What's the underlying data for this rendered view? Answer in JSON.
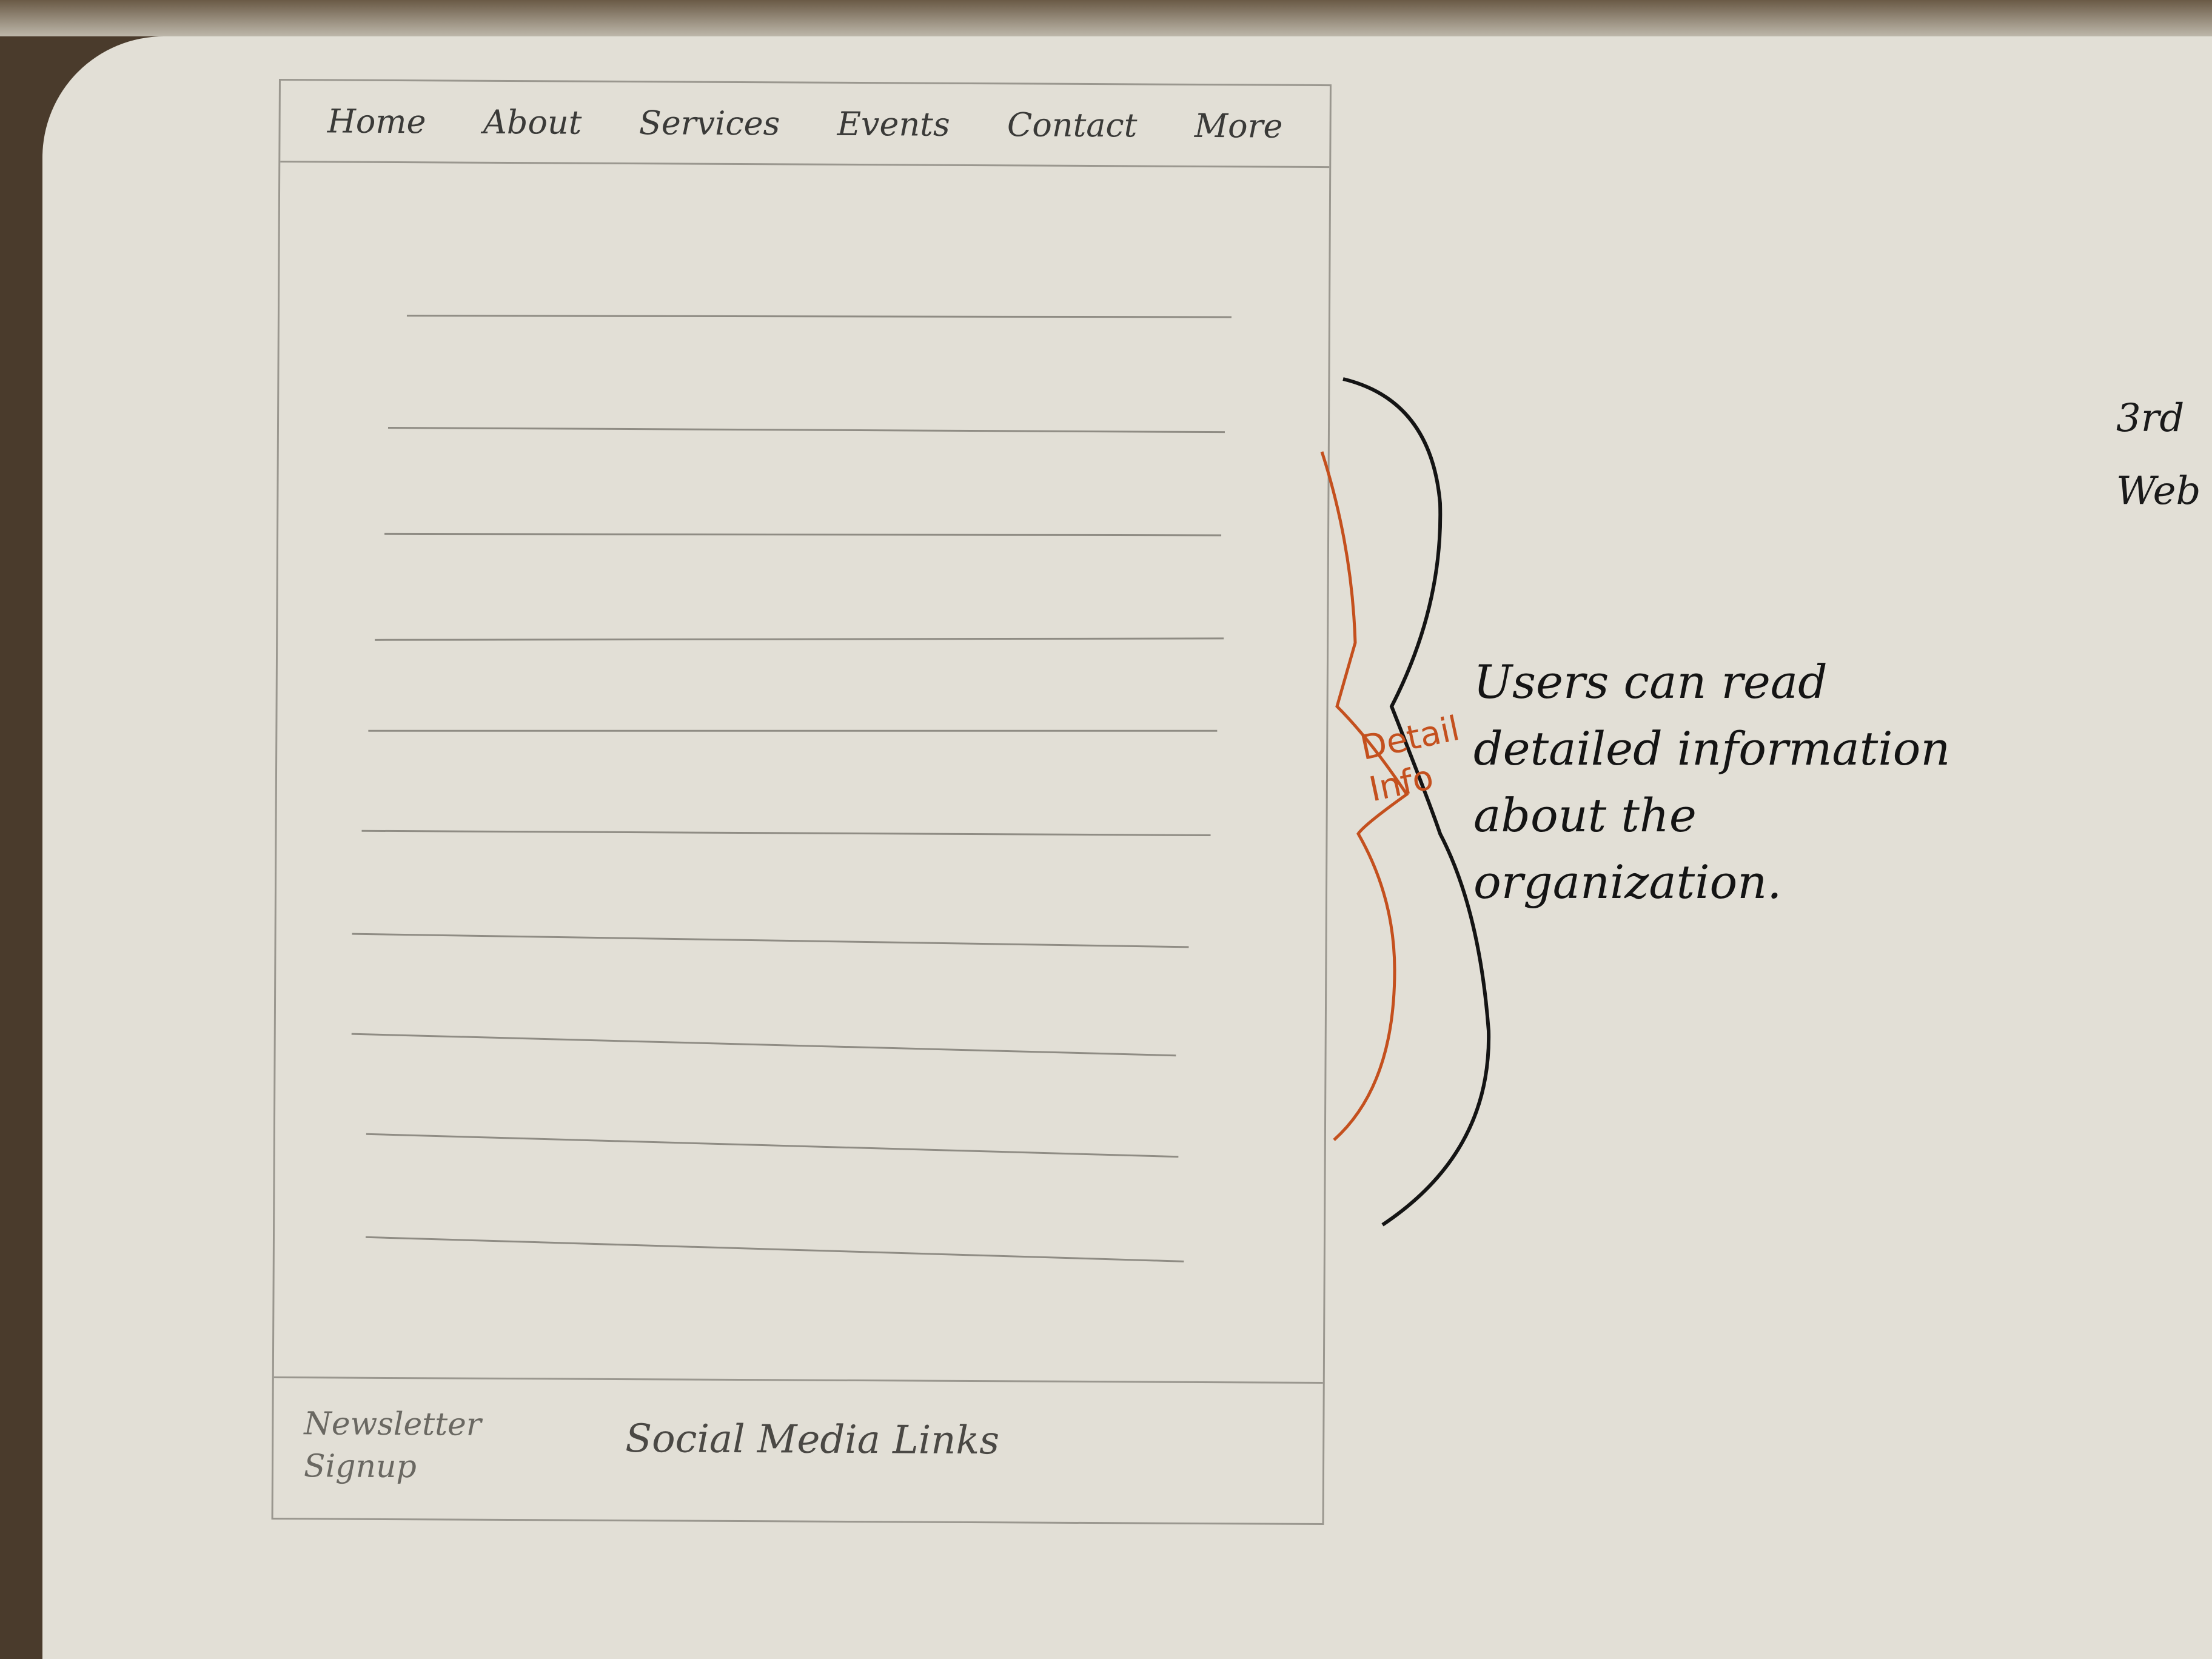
{
  "nav": {
    "items": [
      "Home",
      "About",
      "Services",
      "Events",
      "Contact",
      "More"
    ]
  },
  "main": {
    "line_count": 10
  },
  "footer": {
    "newsletter_label": "Newsletter Signup",
    "social_label": "Social Media Links"
  },
  "annotations": {
    "note": "Users can read detailed information about the organization.",
    "tag": "Detail Info",
    "edge_note": [
      "3rd",
      "Web"
    ]
  },
  "colors": {
    "paper": "#e2dfd6",
    "pencil": "#9a978f",
    "ink": "#141414",
    "orange_ink": "#c4501e"
  }
}
